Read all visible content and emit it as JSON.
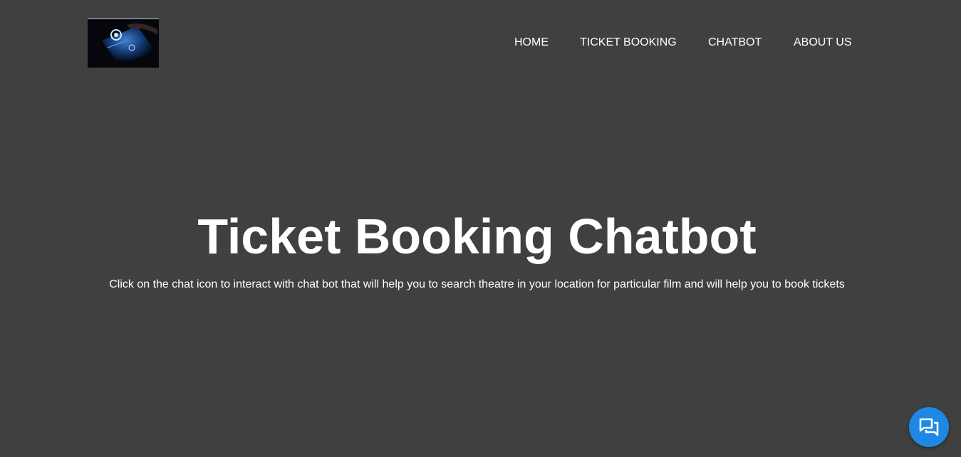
{
  "header": {
    "logo_alt": "Chatbot logo",
    "nav": [
      {
        "label": "HOME"
      },
      {
        "label": "TICKET BOOKING"
      },
      {
        "label": "CHATBOT"
      },
      {
        "label": "ABOUT US"
      }
    ]
  },
  "hero": {
    "title": "Ticket Booking Chatbot",
    "description": "Click on the chat icon to interact with chat bot that will help you to search theatre in your location for particular film and will help you to book tickets"
  },
  "chat_widget": {
    "icon": "chat-bubbles-icon"
  },
  "colors": {
    "background": "#404040",
    "text": "#ffffff",
    "chat_button": "#1e88e5"
  }
}
